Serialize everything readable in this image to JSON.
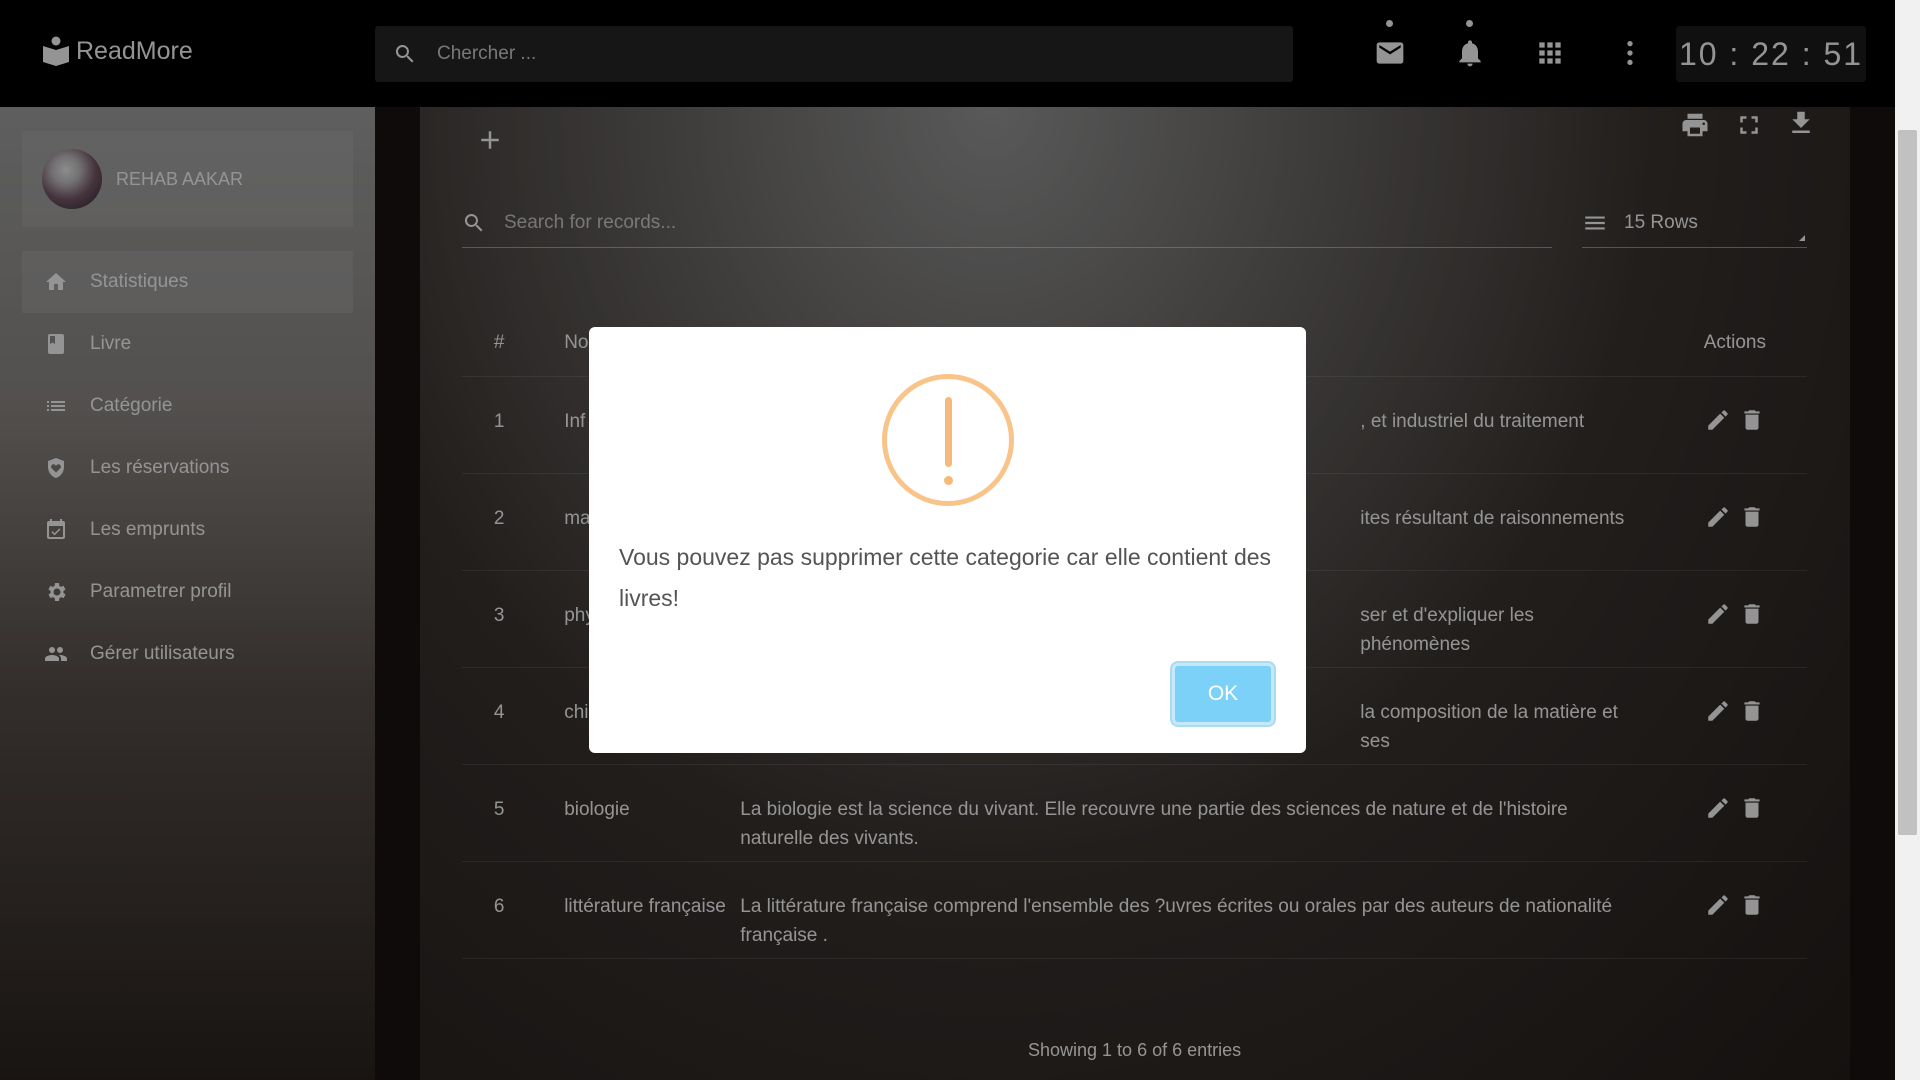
{
  "app": {
    "name": "ReadMore"
  },
  "search": {
    "placeholder": "Chercher ..."
  },
  "clock": "10 : 22 : 51",
  "user": {
    "name": "REHAB AAKAR"
  },
  "sidebar": {
    "items": [
      {
        "label": "Statistiques",
        "icon": "home-icon",
        "active": true
      },
      {
        "label": "Livre",
        "icon": "book-icon"
      },
      {
        "label": "Catégorie",
        "icon": "list-icon"
      },
      {
        "label": "Les réservations",
        "icon": "heart-shield-icon"
      },
      {
        "label": "Les emprunts",
        "icon": "calendar-check-icon"
      },
      {
        "label": "Parametrer profil",
        "icon": "gear-icon"
      },
      {
        "label": "Gérer utilisateurs",
        "icon": "users-icon"
      }
    ]
  },
  "records": {
    "search_placeholder": "Search for records...",
    "rows_label": "15 Rows",
    "columns": {
      "num": "#",
      "name": "No",
      "actions": "Actions"
    },
    "rows": [
      {
        "num": "1",
        "name": "Inf",
        "desc": ", et industriel du traitement"
      },
      {
        "num": "2",
        "name": "ma",
        "desc": "ites résultant de raisonnements"
      },
      {
        "num": "3",
        "name": "phy",
        "desc": "ser et d'expliquer les phénomènes"
      },
      {
        "num": "4",
        "name": "chi",
        "desc": "la composition de la matière et ses"
      },
      {
        "num": "5",
        "name": "biologie",
        "desc": "La biologie est la science du vivant. Elle recouvre une partie des sciences de nature et de l'histoire naturelle des vivants."
      },
      {
        "num": "6",
        "name": "littérature française",
        "desc": "La littérature française comprend l'ensemble des ?uvres écrites ou orales par des auteurs de nationalité française ."
      }
    ],
    "footer": "Showing 1 to 6 of 6 entries"
  },
  "modal": {
    "message": "Vous pouvez pas supprimer cette categorie car elle contient des livres!",
    "ok_label": "OK",
    "icon": "warning-icon",
    "accent_color": "#f8c48a",
    "button_color": "#7cd1f9"
  }
}
